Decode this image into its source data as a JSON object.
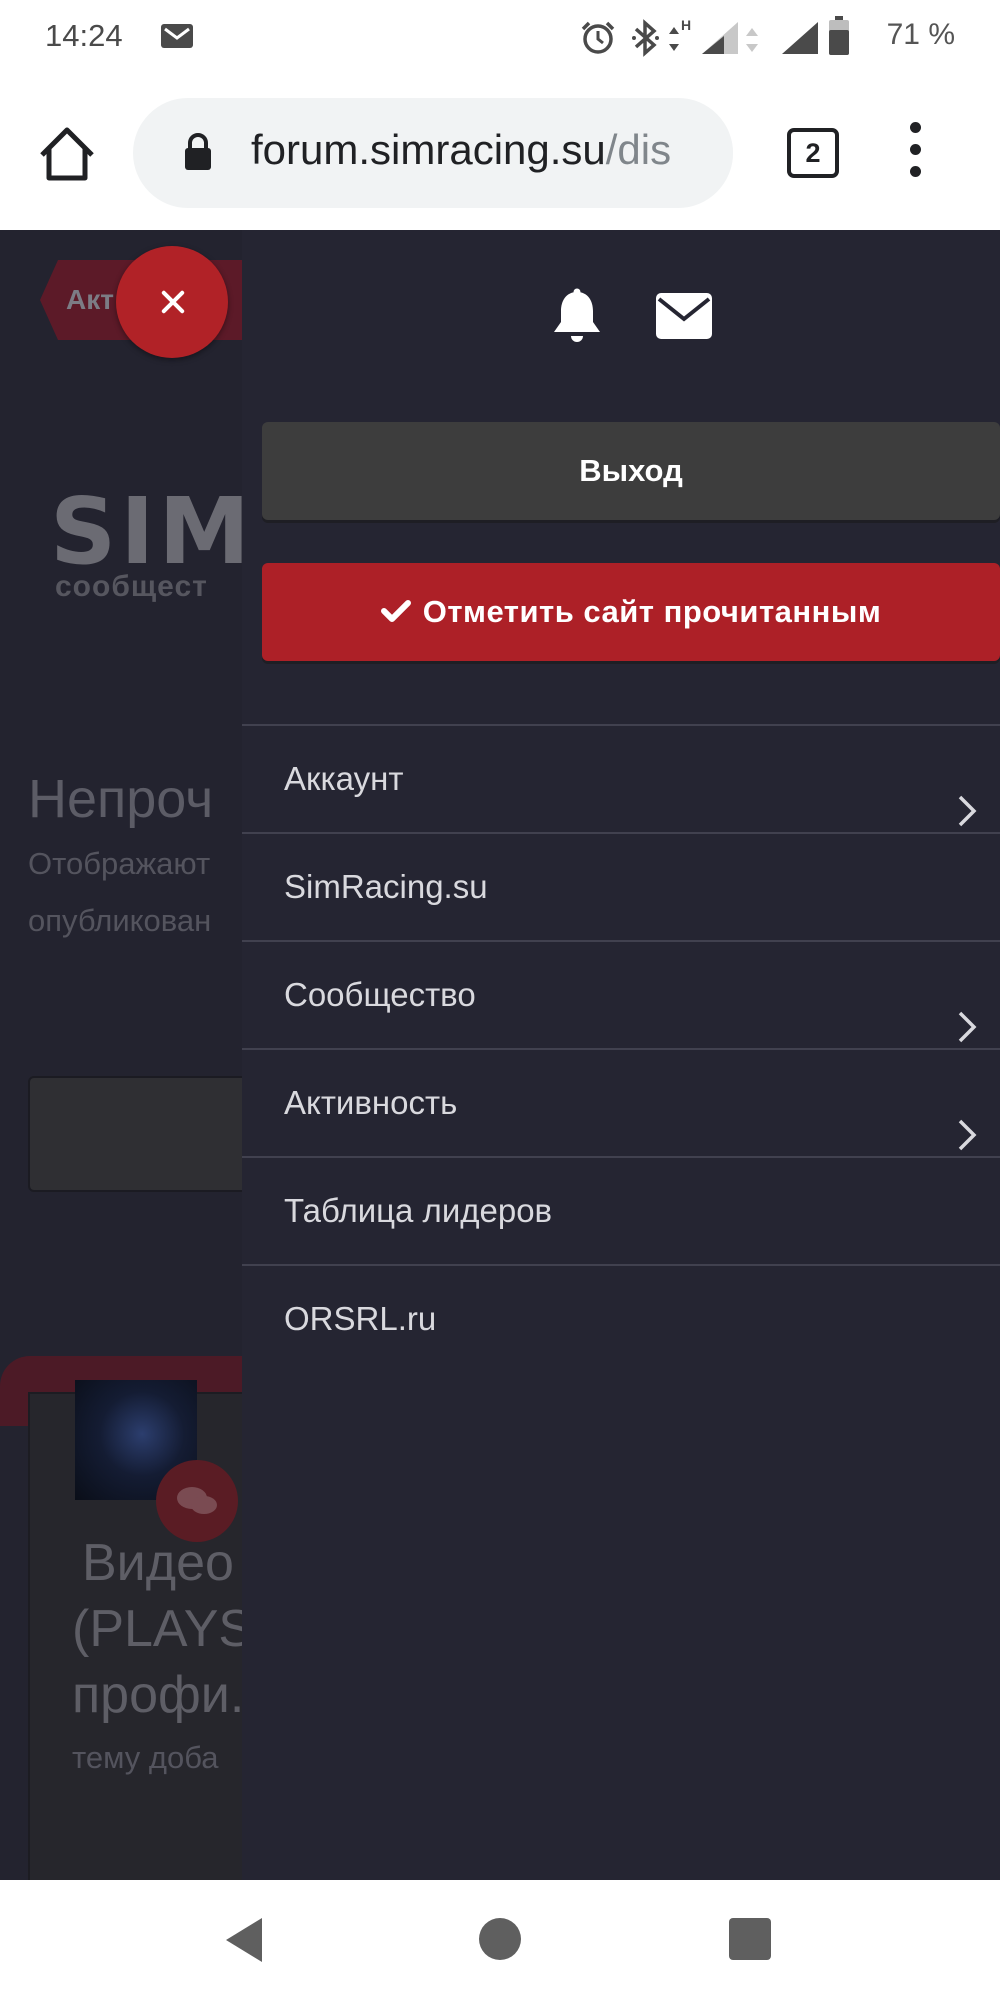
{
  "status_bar": {
    "time": "14:24",
    "battery_text": "71 %",
    "icons": [
      "mail-icon",
      "alarm-icon",
      "bluetooth-icon",
      "data-arrows-icon",
      "signal-icon",
      "signal-icon-2",
      "battery-icon"
    ]
  },
  "browser": {
    "url_host": "forum.simracing.su",
    "url_path": "/dis",
    "tab_count": "2"
  },
  "background_page": {
    "tag": "Акт",
    "logo": "SIM",
    "logo_sub": "сообщест",
    "title": "Непроч",
    "text_line1": "Отображают",
    "text_line2": "опубликован",
    "card_title_1": "Видео",
    "card_title_2": "(PLAYS",
    "card_title_3": "профи.",
    "card_sub": "тему доба"
  },
  "drawer": {
    "logout_label": "Выход",
    "mark_read_label": "Отметить сайт прочитанным",
    "items": [
      {
        "label": "Аккаунт",
        "has_submenu": true
      },
      {
        "label": "SimRacing.su",
        "has_submenu": false
      },
      {
        "label": "Сообщество",
        "has_submenu": true
      },
      {
        "label": "Активность",
        "has_submenu": true
      },
      {
        "label": "Таблица лидеров",
        "has_submenu": false
      },
      {
        "label": "ORSRL.ru",
        "has_submenu": false
      }
    ]
  },
  "colors": {
    "drawer_bg": "#252532",
    "accent_red": "#ad2027",
    "button_dark": "#3d3d3d"
  }
}
